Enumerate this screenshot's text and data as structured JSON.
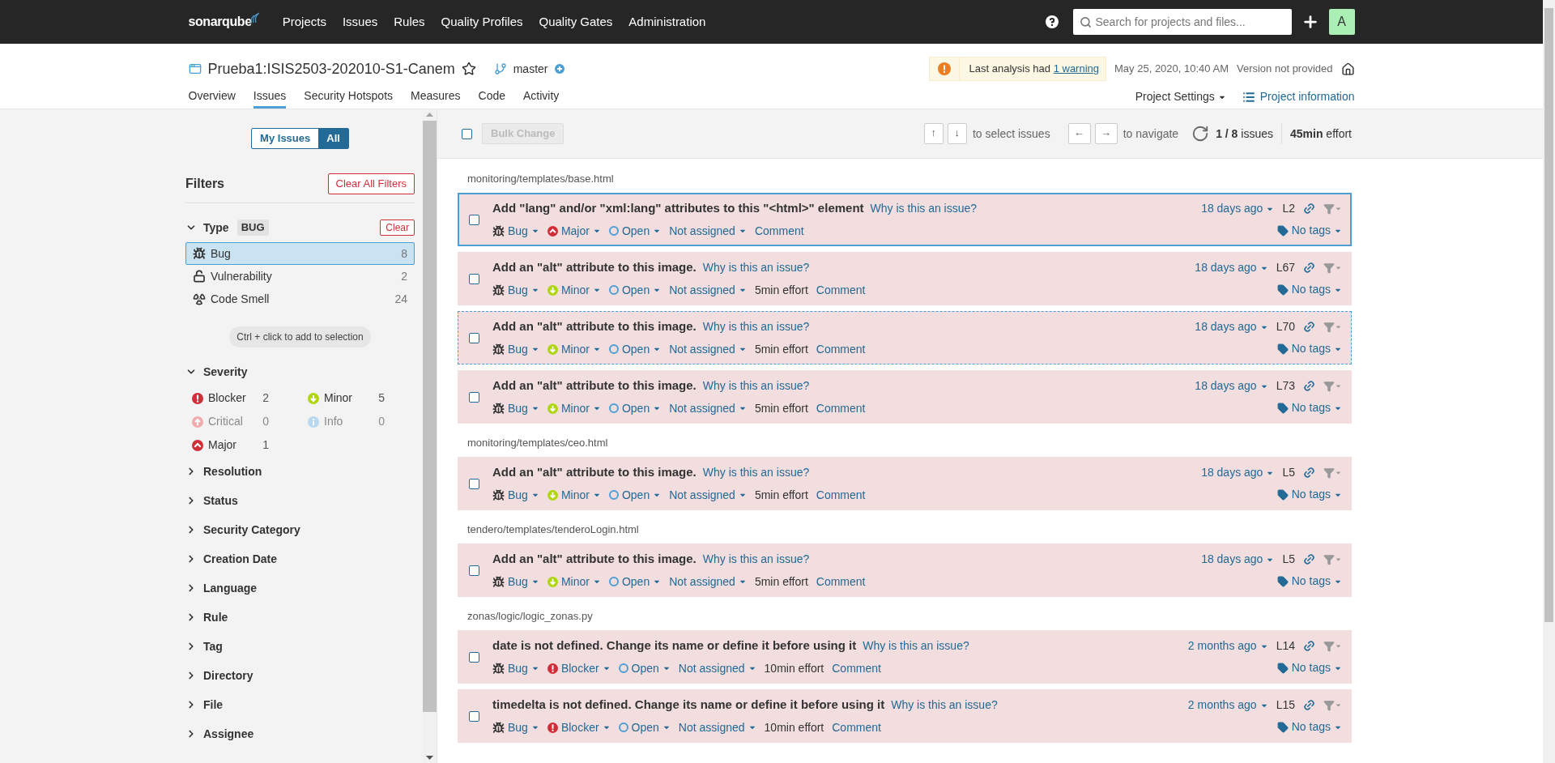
{
  "nav": {
    "logo": "sonarqube",
    "links": [
      {
        "label": "Projects"
      },
      {
        "label": "Issues"
      },
      {
        "label": "Rules"
      },
      {
        "label": "Quality Profiles"
      },
      {
        "label": "Quality Gates"
      },
      {
        "label": "Administration"
      }
    ],
    "search": {
      "placeholder": "Search for projects and files..."
    },
    "avatar": "A"
  },
  "project": {
    "name": "Prueba1:ISIS2503-202010-S1-Canem",
    "favorite": false,
    "branch": "master",
    "warning": {
      "text": "Last analysis had",
      "link": "1 warning"
    },
    "date": "May 25, 2020, 10:40 AM",
    "version": "Version not provided",
    "tabs": [
      {
        "label": "Overview",
        "selected": false
      },
      {
        "label": "Issues",
        "selected": true
      },
      {
        "label": "Security Hotspots",
        "selected": false
      },
      {
        "label": "Measures",
        "selected": false
      },
      {
        "label": "Code",
        "selected": false
      },
      {
        "label": "Activity",
        "selected": false
      }
    ],
    "settings": "Project Settings",
    "info": "Project information"
  },
  "sidebar": {
    "toggle": [
      {
        "label": "My Issues",
        "selected": false
      },
      {
        "label": "All",
        "selected": true
      }
    ],
    "title": "Filters",
    "clear_all": "Clear All Filters",
    "facets": [
      {
        "name": "Type",
        "kind": "type",
        "expanded": true,
        "badge": "BUG",
        "clear": "Clear",
        "hint": "Ctrl + click to add to selection",
        "items": [
          {
            "label": "Bug",
            "count": "8",
            "kind": "bug",
            "selected": true
          },
          {
            "label": "Vulnerability",
            "count": "2",
            "kind": "vulnerability",
            "selected": false
          },
          {
            "label": "Code Smell",
            "count": "24",
            "kind": "smell",
            "selected": false
          }
        ]
      },
      {
        "name": "Severity",
        "kind": "severity",
        "expanded": true,
        "items": [
          {
            "label": "Blocker",
            "count": "2",
            "kind": "blocker",
            "disabled": false
          },
          {
            "label": "Minor",
            "count": "5",
            "kind": "minor",
            "disabled": false
          },
          {
            "label": "Critical",
            "count": "0",
            "kind": "critical",
            "disabled": true
          },
          {
            "label": "Info",
            "count": "0",
            "kind": "info",
            "disabled": true
          },
          {
            "label": "Major",
            "count": "1",
            "kind": "major",
            "disabled": false
          }
        ]
      },
      {
        "name": "Resolution",
        "expanded": false
      },
      {
        "name": "Status",
        "expanded": false
      },
      {
        "name": "Security Category",
        "expanded": false
      },
      {
        "name": "Creation Date",
        "expanded": false
      },
      {
        "name": "Language",
        "expanded": false
      },
      {
        "name": "Rule",
        "expanded": false
      },
      {
        "name": "Tag",
        "expanded": false
      },
      {
        "name": "Directory",
        "expanded": false
      },
      {
        "name": "File",
        "expanded": false
      },
      {
        "name": "Assignee",
        "expanded": false
      }
    ]
  },
  "toolbar": {
    "checked": false,
    "bulk_change": "Bulk Change",
    "bulk_disabled": true,
    "select_keys": [
      "↑",
      "↓"
    ],
    "select_hint": "to select issues",
    "navigate_keys": [
      "←",
      "→"
    ],
    "navigate_hint": "to navigate",
    "position": "1 / 8",
    "position_label": "issues",
    "effort": "45min",
    "effort_label": "effort"
  },
  "groups": [
    {
      "file": "monitoring/templates/base.html",
      "issues": [
        {
          "message": "Add \"lang\" and/or \"xml:lang\" attributes to this \"<html>\" element",
          "why": "Why is this an issue?",
          "type": "Bug",
          "severity": {
            "label": "Major",
            "kind": "major"
          },
          "status": "Open",
          "assignee": "Not assigned",
          "comment": "Comment",
          "age": "18 days ago",
          "line": "L2",
          "tags": "No tags",
          "checked": false,
          "selected": true,
          "focused": false
        },
        {
          "message": "Add an \"alt\" attribute to this image.",
          "why": "Why is this an issue?",
          "type": "Bug",
          "severity": {
            "label": "Minor",
            "kind": "minor"
          },
          "status": "Open",
          "assignee": "Not assigned",
          "effort": "5min effort",
          "comment": "Comment",
          "age": "18 days ago",
          "line": "L67",
          "tags": "No tags",
          "checked": false,
          "selected": false,
          "focused": false
        },
        {
          "message": "Add an \"alt\" attribute to this image.",
          "why": "Why is this an issue?",
          "type": "Bug",
          "severity": {
            "label": "Minor",
            "kind": "minor"
          },
          "status": "Open",
          "assignee": "Not assigned",
          "effort": "5min effort",
          "comment": "Comment",
          "age": "18 days ago",
          "line": "L70",
          "tags": "No tags",
          "checked": false,
          "selected": false,
          "focused": true
        },
        {
          "message": "Add an \"alt\" attribute to this image.",
          "why": "Why is this an issue?",
          "type": "Bug",
          "severity": {
            "label": "Minor",
            "kind": "minor"
          },
          "status": "Open",
          "assignee": "Not assigned",
          "effort": "5min effort",
          "comment": "Comment",
          "age": "18 days ago",
          "line": "L73",
          "tags": "No tags",
          "checked": false,
          "selected": false,
          "focused": false
        }
      ]
    },
    {
      "file": "monitoring/templates/ceo.html",
      "issues": [
        {
          "message": "Add an \"alt\" attribute to this image.",
          "why": "Why is this an issue?",
          "type": "Bug",
          "severity": {
            "label": "Minor",
            "kind": "minor"
          },
          "status": "Open",
          "assignee": "Not assigned",
          "effort": "5min effort",
          "comment": "Comment",
          "age": "18 days ago",
          "line": "L5",
          "tags": "No tags",
          "checked": false,
          "selected": false,
          "focused": false
        }
      ]
    },
    {
      "file": "tendero/templates/tenderoLogin.html",
      "issues": [
        {
          "message": "Add an \"alt\" attribute to this image.",
          "why": "Why is this an issue?",
          "type": "Bug",
          "severity": {
            "label": "Minor",
            "kind": "minor"
          },
          "status": "Open",
          "assignee": "Not assigned",
          "effort": "5min effort",
          "comment": "Comment",
          "age": "18 days ago",
          "line": "L5",
          "tags": "No tags",
          "checked": false,
          "selected": false,
          "focused": false
        }
      ]
    },
    {
      "file": "zonas/logic/logic_zonas.py",
      "issues": [
        {
          "message": "date is not defined. Change its name or define it before using it",
          "why": "Why is this an issue?",
          "type": "Bug",
          "severity": {
            "label": "Blocker",
            "kind": "blocker"
          },
          "status": "Open",
          "assignee": "Not assigned",
          "effort": "10min effort",
          "comment": "Comment",
          "age": "2 months ago",
          "line": "L14",
          "tags": "No tags",
          "checked": false,
          "selected": false,
          "focused": false
        },
        {
          "message": "timedelta is not defined. Change its name or define it before using it",
          "why": "Why is this an issue?",
          "type": "Bug",
          "severity": {
            "label": "Blocker",
            "kind": "blocker"
          },
          "status": "Open",
          "assignee": "Not assigned",
          "effort": "10min effort",
          "comment": "Comment",
          "age": "2 months ago",
          "line": "L15",
          "tags": "No tags",
          "checked": false,
          "selected": false,
          "focused": false
        }
      ]
    }
  ]
}
